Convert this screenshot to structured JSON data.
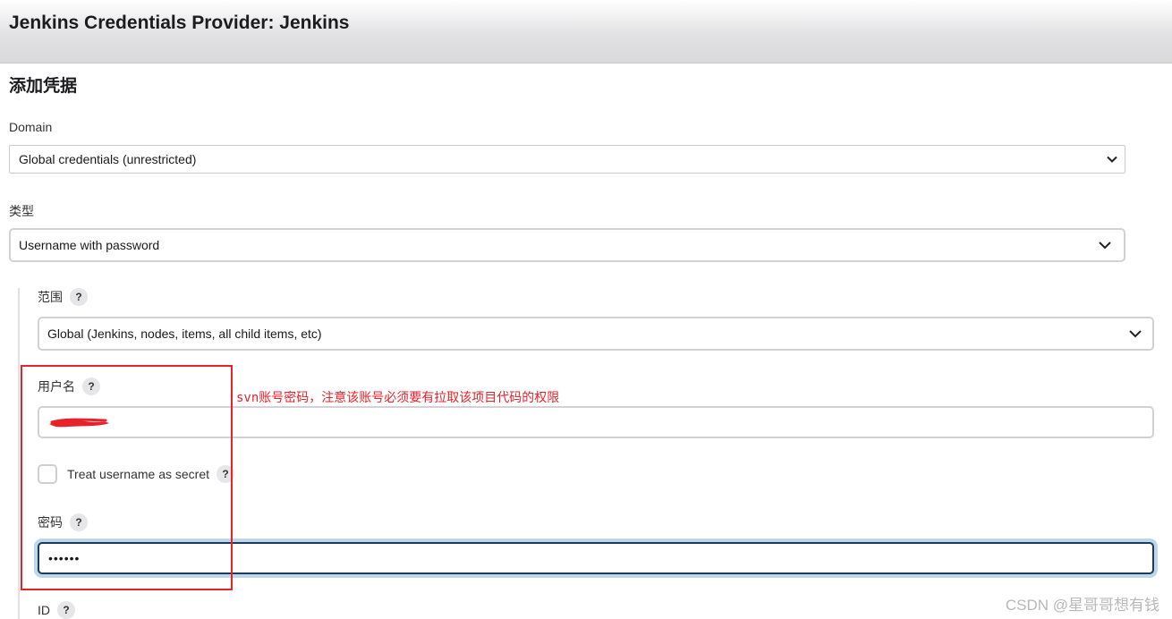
{
  "header": {
    "title": "Jenkins Credentials Provider: Jenkins"
  },
  "section": {
    "title": "添加凭据"
  },
  "domain": {
    "label": "Domain",
    "selected": "Global credentials (unrestricted)"
  },
  "kind": {
    "label": "类型",
    "selected": "Username with password"
  },
  "scope": {
    "label": "范围",
    "help": "?",
    "selected": "Global (Jenkins, nodes, items, all child items, etc)"
  },
  "username": {
    "label": "用户名",
    "help": "?"
  },
  "treat_secret": {
    "label": "Treat username as secret",
    "help": "?",
    "checked": false
  },
  "password": {
    "label": "密码",
    "help": "?",
    "value": "••••••"
  },
  "id_field": {
    "label": "ID",
    "help": "?"
  },
  "annotation": {
    "prefix": "svn",
    "text": "账号密码，注意该账号必须要有拉取该项目代码的权限",
    "color": "#e8222a"
  },
  "watermark": {
    "text": "CSDN @星哥哥想有钱"
  },
  "colors": {
    "focus_border": "#1b3b57",
    "focus_glow": "#bcd7ea",
    "annotation_red": "#e8222a"
  }
}
